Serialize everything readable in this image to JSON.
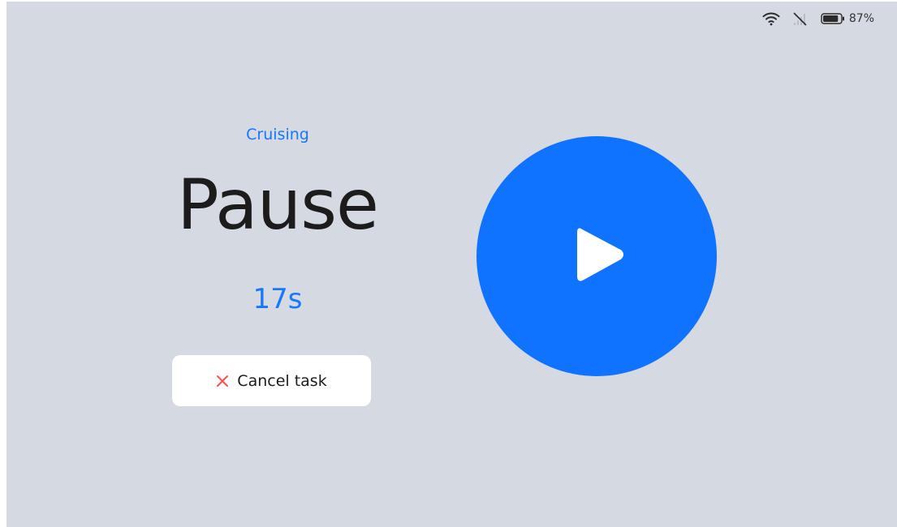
{
  "status_bar": {
    "wifi_icon": "wifi-icon",
    "signal_icon": "no-signal-icon",
    "battery_icon": "battery-icon",
    "battery_percent": "87%",
    "battery_level": 0.87
  },
  "main": {
    "mode": "Cruising",
    "state": "Pause",
    "countdown": "17s",
    "cancel_button": {
      "icon": "close-icon",
      "label": "Cancel task"
    },
    "play_button": {
      "icon": "play-icon"
    }
  },
  "colors": {
    "background": "#d5d9e2",
    "accent": "#1677ff",
    "play_circle": "#0f73ff",
    "cancel_icon": "#ff4d4f",
    "title": "#1c1c1c"
  }
}
